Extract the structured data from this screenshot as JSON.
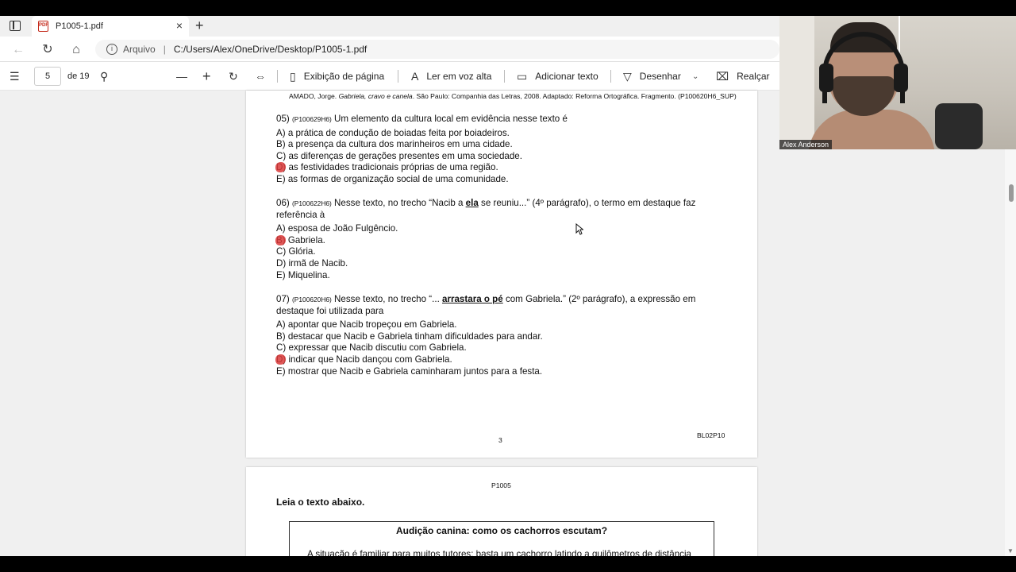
{
  "browser": {
    "tab_title": "P1005-1.pdf",
    "tab_close": "×",
    "new_tab": "+",
    "address_label": "Arquivo",
    "address_separator": "|",
    "url": "C:/Users/Alex/OneDrive/Desktop/P1005-1.pdf"
  },
  "pdf_toolbar": {
    "page_current": "5",
    "page_total": "de 19",
    "page_view": "Exibição de página",
    "read_aloud": "Ler em voz alta",
    "add_text": "Adicionar texto",
    "draw": "Desenhar",
    "highlight": "Realçar"
  },
  "webcam": {
    "name": "Alex Anderson"
  },
  "page1": {
    "citation_author": "AMADO, Jorge. ",
    "citation_title": "Gabriela, cravo e canela",
    "citation_rest": ". São Paulo: Companhia das Letras, 2008. Adaptado: Reforma Ortográfica. Fragmento. (P100620H6_SUP)",
    "questions": [
      {
        "number": "05)",
        "code": "(P100629H6)",
        "stem_before": " Um elemento da cultura local em evidência nesse texto é",
        "stem_emphasis": "",
        "stem_after": "",
        "options": [
          "A) a prática de condução de boiadas feita por boiadeiros.",
          "B) a presença da cultura dos marinheiros em uma cidade.",
          "C) as diferenças de gerações presentes em uma sociedade.",
          "D) as festividades tradicionais próprias de uma região.",
          "E) as formas de organização social de uma comunidade."
        ]
      },
      {
        "number": "06)",
        "code": "(P100622H6)",
        "stem_before": " Nesse texto, no trecho “Nacib a ",
        "stem_emphasis": "ela",
        "stem_after": " se reuniu...” (4º parágrafo), o termo em destaque faz referência à",
        "options": [
          "A) esposa de João Fulgêncio.",
          "B) Gabriela.",
          "C) Glória.",
          "D) irmã de Nacib.",
          "E) Miquelina."
        ]
      },
      {
        "number": "07)",
        "code": "(P100620H6)",
        "stem_before": " Nesse texto, no trecho “... ",
        "stem_emphasis": "arrastara o pé",
        "stem_after": " com Gabriela.” (2º parágrafo), a expressão em destaque foi utilizada para",
        "options": [
          "A) apontar que Nacib tropeçou em Gabriela.",
          "B) destacar que Nacib e Gabriela tinham dificuldades para andar.",
          "C) expressar que Nacib discutiu com Gabriela.",
          "D) indicar que Nacib dançou com Gabriela.",
          "E) mostrar que Nacib e Gabriela caminharam juntos para a festa."
        ]
      }
    ],
    "page_number": "3",
    "footer_code": "BL02P10"
  },
  "page2": {
    "header": "P1005",
    "instruction": "Leia o texto abaixo.",
    "box_title": "Audição canina: como os cachorros escutam?",
    "box_text": "A situação é familiar para muitos tutores: basta um cachorro latindo a quilômetros de distância"
  },
  "colors": {
    "annotation_mark": "#d93a3a",
    "tab_pdf_icon": "#c42b1c"
  }
}
